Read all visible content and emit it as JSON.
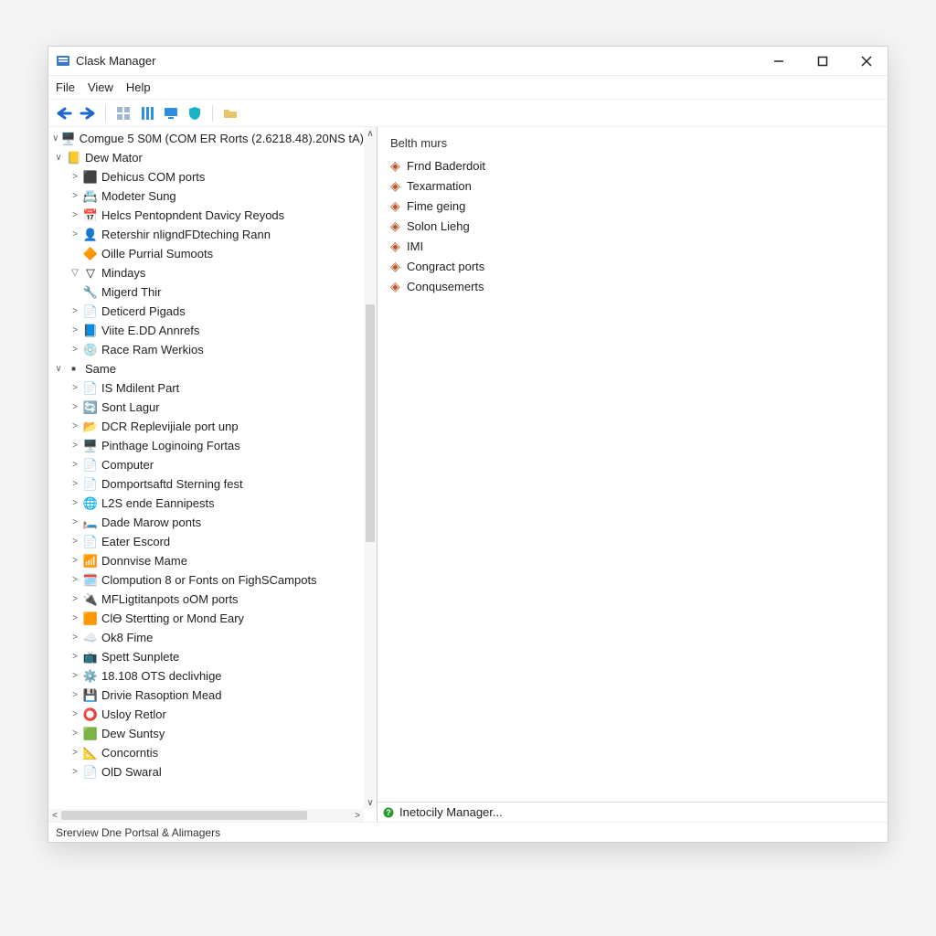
{
  "window": {
    "title": "Clask Manager"
  },
  "menubar": {
    "file": "File",
    "view": "View",
    "help": "Help"
  },
  "toolbar": {
    "back": "back-arrow-icon",
    "forward": "forward-arrow-icon",
    "b1": "toolbar-tile-icon",
    "b2": "toolbar-columns-icon",
    "b3": "toolbar-monitor-icon",
    "b4": "toolbar-shield-icon",
    "b5": "toolbar-folder-icon"
  },
  "tree": {
    "root": {
      "label": "Comgue 5 S0M (COM ER Rorts (2.6218.48).20NS tA)"
    },
    "groupA": {
      "label": "Dew Mator",
      "children": [
        {
          "label": "Dehicus COM ports",
          "icon": "⬛"
        },
        {
          "label": "Modeter Sung",
          "icon": "📇"
        },
        {
          "label": "Helcs Pentopndent Davicy Reyods",
          "icon": "📅"
        },
        {
          "label": "Retershir nligndFDteching Rann",
          "icon": "👤"
        },
        {
          "label": "Oille Purrial Sumoots",
          "icon": "🔶",
          "nochev": true
        },
        {
          "label": "Mindays",
          "icon": "▽",
          "chev": "▽"
        },
        {
          "label": "Migerd Thir",
          "icon": "🔧",
          "nochev": true
        },
        {
          "label": "Deticerd Pigads",
          "icon": "📄"
        },
        {
          "label": "Viite E.DD Annrefs",
          "icon": "📘"
        },
        {
          "label": "Race Ram Werkios",
          "icon": "💿"
        }
      ]
    },
    "groupB": {
      "label": "Same",
      "children": [
        {
          "label": "IS Mdilent Part",
          "icon": "📄"
        },
        {
          "label": "Sont Lagur",
          "icon": "🔄"
        },
        {
          "label": "DCR Replevijiale port unp",
          "icon": "📂"
        },
        {
          "label": "Pinthage Loginoing Fortas",
          "icon": "🖥️"
        },
        {
          "label": "Computer",
          "icon": "📄"
        },
        {
          "label": "Domportsaftd Sterning fest",
          "icon": "📄"
        },
        {
          "label": "L2S ende Eannipests",
          "icon": "🌐"
        },
        {
          "label": "Dade Marow ponts",
          "icon": "🛏️"
        },
        {
          "label": "Eater Escord",
          "icon": "📄"
        },
        {
          "label": "Donnvise Mame",
          "icon": "📶"
        },
        {
          "label": "Clompution 8 or Fonts on FighSCampots",
          "icon": "🗓️"
        },
        {
          "label": "MFLigtitanpots oOM ports",
          "icon": "🔌"
        },
        {
          "label": "ClӨ Stertting or Mond Eary",
          "icon": "🟧"
        },
        {
          "label": "Ok8 Fime",
          "icon": "☁️"
        },
        {
          "label": "Spett Sunplete",
          "icon": "📺"
        },
        {
          "label": "18.108 OTS declivhige",
          "icon": "⚙️"
        },
        {
          "label": "Drivie Rasoption Mead",
          "icon": "💾"
        },
        {
          "label": "Usloy Retlor",
          "icon": "⭕"
        },
        {
          "label": "Dew Suntsy",
          "icon": "🟩"
        },
        {
          "label": "Concorntis",
          "icon": "📐"
        },
        {
          "label": "OlD Swaral",
          "icon": "📄"
        }
      ]
    }
  },
  "right": {
    "heading": "Belth murs",
    "links": [
      "Frnd Baderdoit",
      "Texarmation",
      "Fime geing",
      "Solon Liehg",
      "IMI",
      "Congract ports",
      "Conqusemerts"
    ],
    "status": "Inetocily Manager..."
  },
  "statusbar": {
    "text": "Srerview Dne Portsal & Alimagers"
  }
}
